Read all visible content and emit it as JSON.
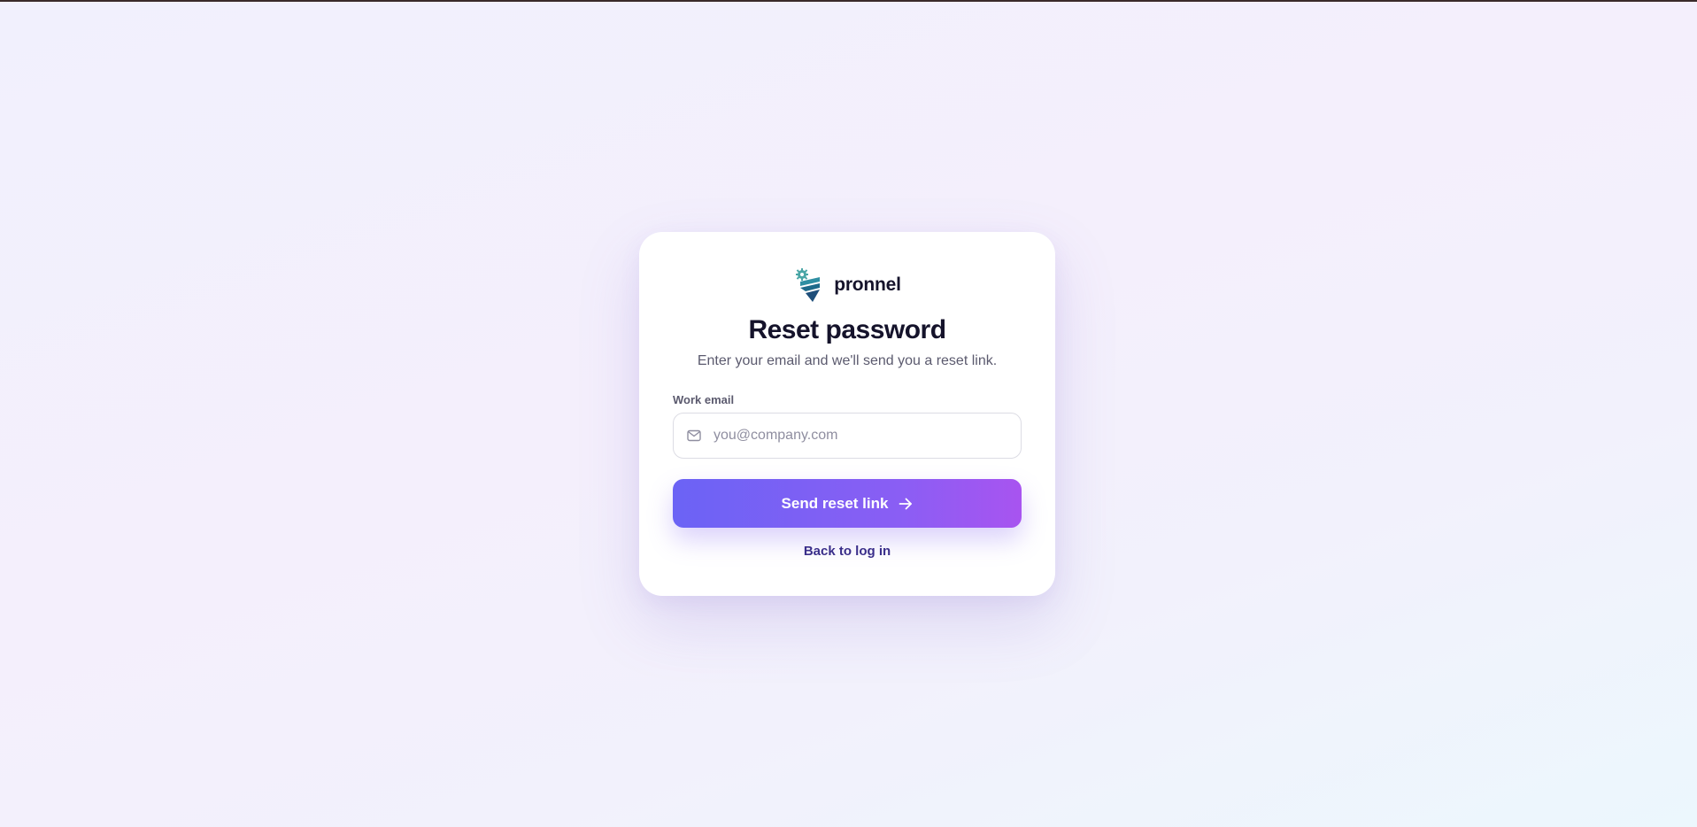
{
  "brand": {
    "name": "pronnel",
    "logo_icon": "pronnel-logo-icon"
  },
  "page": {
    "title": "Reset password",
    "subtitle": "Enter your email and we'll send you a reset link."
  },
  "form": {
    "email_label": "Work email",
    "email_value": "",
    "email_placeholder": "you@company.com",
    "email_icon": "mail-icon",
    "submit_label": "Send reset link",
    "submit_icon": "arrow-right-icon",
    "back_link": "Back to log in"
  },
  "colors": {
    "button_start": "#6b63f5",
    "button_end": "#a854f0",
    "title": "#15132b",
    "link": "#3a2e8a",
    "logo_teal": "#2f8fa3",
    "logo_navy": "#1e4e7a"
  }
}
